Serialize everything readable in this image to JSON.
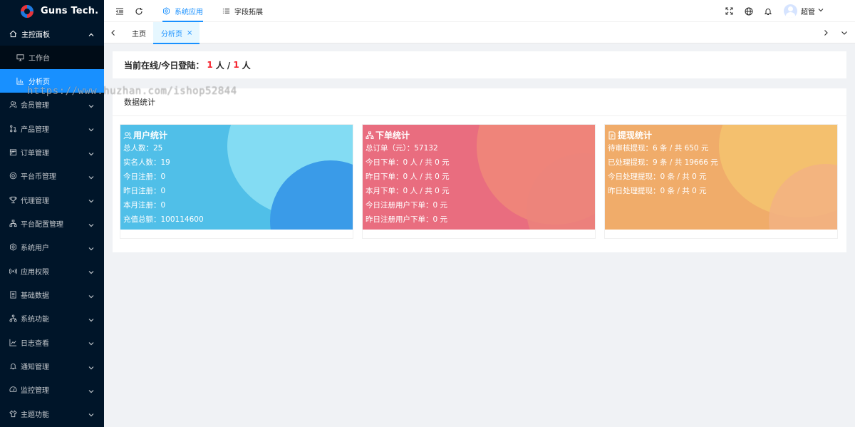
{
  "app": {
    "logo_text": "Guns Tech."
  },
  "sidebar": {
    "parent": {
      "label": "主控面板",
      "icon": "home-icon"
    },
    "subitems": [
      {
        "label": "工作台",
        "icon": "desktop-icon"
      },
      {
        "label": "分析页",
        "icon": "bar-chart-icon",
        "active": true
      }
    ],
    "items": [
      {
        "label": "会员管理",
        "icon": "users-icon"
      },
      {
        "label": "产品管理",
        "icon": "pull-request-icon"
      },
      {
        "label": "订单管理",
        "icon": "calendar-icon"
      },
      {
        "label": "平台币管理",
        "icon": "coin-icon"
      },
      {
        "label": "代理管理",
        "icon": "trophy-icon"
      },
      {
        "label": "平台配置管理",
        "icon": "sitemap-icon"
      },
      {
        "label": "系统用户",
        "icon": "gear-icon"
      },
      {
        "label": "应用权限",
        "icon": "radar-icon"
      },
      {
        "label": "基础数据",
        "icon": "book-icon"
      },
      {
        "label": "系统功能",
        "icon": "apartment-icon"
      },
      {
        "label": "日志查看",
        "icon": "line-chart-icon"
      },
      {
        "label": "通知管理",
        "icon": "bell-icon"
      },
      {
        "label": "监控管理",
        "icon": "dashboard-icon"
      },
      {
        "label": "主题功能",
        "icon": "skin-icon"
      }
    ]
  },
  "header": {
    "tabs": [
      {
        "label": "系统应用",
        "icon": "settings-icon",
        "active": true
      },
      {
        "label": "字段拓展",
        "icon": "list-icon"
      }
    ],
    "user": {
      "name": "超管"
    }
  },
  "pagetabs": {
    "home": "主页",
    "current": "分析页",
    "close": "×"
  },
  "online": {
    "label": "当前在线/今日登陆：",
    "online_count": "1",
    "unit1": "人 /",
    "today_count": "1",
    "unit2": "人"
  },
  "stats": {
    "title": "数据统计",
    "cards": [
      {
        "title": "用户统计",
        "icon": "user-group-icon",
        "color": "#50bfe8",
        "lines": [
          "总人数：25",
          "实名人数：19",
          "今日注册：0",
          "昨日注册：0",
          "本月注册：0",
          "充值总额：100114600"
        ]
      },
      {
        "title": "下单统计",
        "icon": "sitemap-icon",
        "color": "#e96d7f",
        "lines": [
          "总订单（元）：57132",
          "今日下单：0 人 / 共 0 元",
          "昨日下单：0 人 / 共 0 元",
          "本月下单：0 人 / 共 0 元",
          "今日注册用户下单：0 元",
          "昨日注册用户下单：0 元"
        ]
      },
      {
        "title": "提现统计",
        "icon": "file-icon",
        "color": "#f0ac6a",
        "lines": [
          "待审核提现：6 条 / 共 650 元",
          "已处理提现：9 条 / 共 19666 元",
          "今日处理提现：0 条 / 共 0 元",
          "昨日处理提现：0 条 / 共 0 元"
        ]
      }
    ]
  },
  "watermark": "https://www.huzhan.com/ishop52844"
}
